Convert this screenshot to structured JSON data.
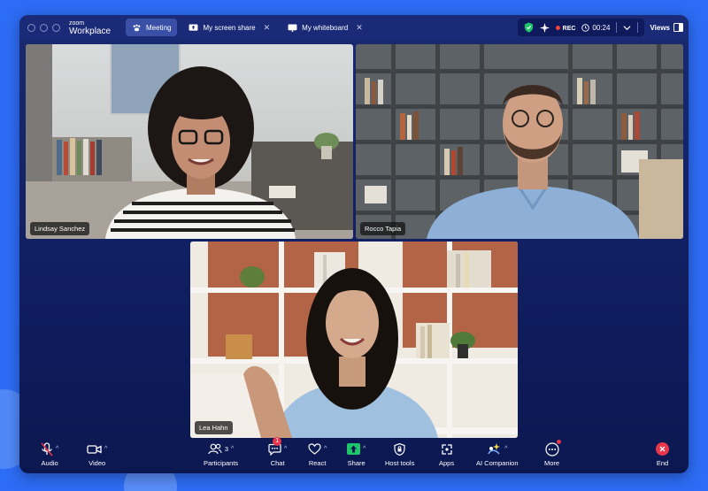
{
  "app": {
    "logo_top": "zoom",
    "logo_bottom": "Workplace"
  },
  "tabs": [
    {
      "label": "Meeting",
      "icon": "paw-icon",
      "active": true
    },
    {
      "label": "My screen share",
      "icon": "screen-share-icon",
      "closable": true
    },
    {
      "label": "My whiteboard",
      "icon": "whiteboard-icon",
      "closable": true
    }
  ],
  "status": {
    "rec_label": "REC",
    "timer": "00:24",
    "views_label": "Views",
    "rec_color": "#ff3b3b",
    "shield_color": "#1ec46a"
  },
  "participants": [
    {
      "name": "Lindsay Sanchez"
    },
    {
      "name": "Rocco Tapia"
    },
    {
      "name": "Lea Hahn"
    }
  ],
  "toolbar": {
    "audio": "Audio",
    "video": "Video",
    "participants": "Participants",
    "participants_count": "3",
    "chat": "Chat",
    "chat_badge": "1",
    "react": "React",
    "share": "Share",
    "host_tools": "Host tools",
    "apps": "Apps",
    "ai_companion": "AI Companion",
    "more": "More",
    "end": "End"
  },
  "colors": {
    "accent": "#2d6cf5",
    "end": "#e8354a",
    "share": "#1ec46a"
  }
}
